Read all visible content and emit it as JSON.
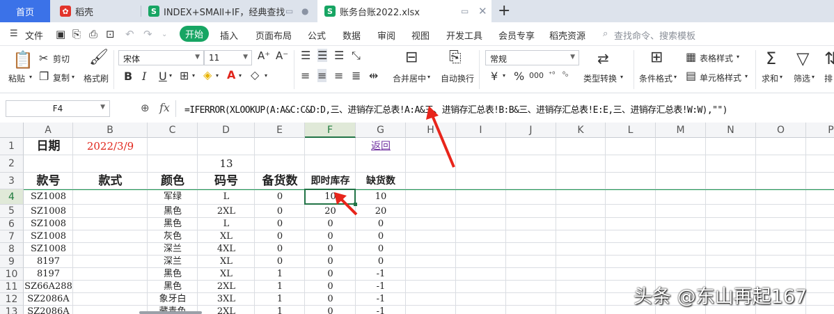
{
  "tabs": {
    "home": "首页",
    "tab1": "稻壳",
    "tab2": "INDEX+SMAll+IF，经典查找",
    "tab3": "账务台账2022.xlsx",
    "add": "+"
  },
  "menu": {
    "file": "文件",
    "items": [
      "开始",
      "插入",
      "页面布局",
      "公式",
      "数据",
      "审阅",
      "视图",
      "开发工具",
      "会员专享",
      "稻壳资源"
    ],
    "search": "查找命令、搜索模板"
  },
  "ribbon": {
    "paste": "粘贴",
    "cut": "剪切",
    "copy": "复制",
    "format_painter": "格式刷",
    "font_name": "宋体",
    "font_size": "11",
    "merge_center": "合并居中",
    "wrap_text": "自动换行",
    "number_format": "常规",
    "type_convert": "类型转换",
    "conditional_format": "条件格式",
    "table_style": "表格样式",
    "cell_style": "单元格样式",
    "sum": "求和",
    "filter": "筛选",
    "sort": "排"
  },
  "formula_bar": {
    "name_box": "F4",
    "fx": "fx",
    "formula": "=IFERROR(XLOOKUP(A:A&C:C&D:D,三、进销存汇总表!A:A&三、进销存汇总表!B:B&三、进销存汇总表!E:E,三、进销存汇总表!W:W),\"\")"
  },
  "columns": [
    "A",
    "B",
    "C",
    "D",
    "E",
    "F",
    "G",
    "H",
    "I",
    "J",
    "K",
    "L",
    "M",
    "N",
    "O",
    "P"
  ],
  "rows": [
    "1",
    "2",
    "3",
    "4",
    "5",
    "6",
    "7",
    "8",
    "9",
    "10",
    "11",
    "12",
    "13"
  ],
  "sheet": {
    "r1": {
      "date_label": "日期",
      "date_value": "2022/3/9",
      "back_link": "返回"
    },
    "r2": {
      "d": "13"
    },
    "r3": {
      "a": "款号",
      "b": "款式",
      "c": "颜色",
      "d": "码号",
      "e": "备货数",
      "f": "即时库存",
      "g": "缺货数"
    },
    "data": [
      {
        "a": "SZ1008",
        "c": "军绿",
        "d": "L",
        "e": "0",
        "f": "10",
        "g": "10"
      },
      {
        "a": "SZ1008",
        "c": "黑色",
        "d": "2XL",
        "e": "0",
        "f": "20",
        "g": "20"
      },
      {
        "a": "SZ1008",
        "c": "黑色",
        "d": "L",
        "e": "0",
        "f": "0",
        "g": "0"
      },
      {
        "a": "SZ1008",
        "c": "灰色",
        "d": "XL",
        "e": "0",
        "f": "0",
        "g": "0"
      },
      {
        "a": "SZ1008",
        "c": "深兰",
        "d": "4XL",
        "e": "0",
        "f": "0",
        "g": "0"
      },
      {
        "a": "8197",
        "c": "深兰",
        "d": "XL",
        "e": "0",
        "f": "0",
        "g": "0"
      },
      {
        "a": "8197",
        "c": "黑色",
        "d": "XL",
        "e": "1",
        "f": "0",
        "g": "-1"
      },
      {
        "a": "SZ66A288",
        "c": "黑色",
        "d": "2XL",
        "e": "1",
        "f": "0",
        "g": "-1"
      },
      {
        "a": "SZ2086A",
        "c": "象牙白",
        "d": "3XL",
        "e": "1",
        "f": "0",
        "g": "-1"
      },
      {
        "a": "SZ2086A",
        "c": "藏青色",
        "d": "2XL",
        "e": "1",
        "f": "0",
        "g": "-1"
      }
    ]
  },
  "watermark": "头条 @东山再起167",
  "colors": {
    "accent_green": "#217346",
    "date_red": "#e0251b",
    "link_purple": "#7030a0",
    "arrow_red": "#e8251b"
  }
}
